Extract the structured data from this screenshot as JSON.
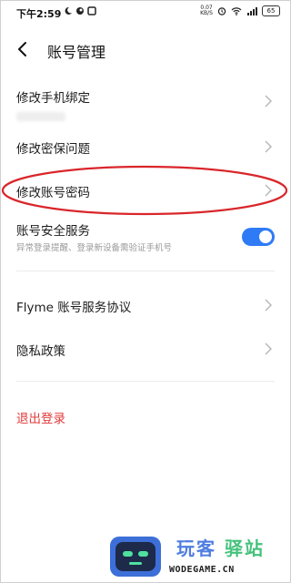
{
  "status_bar": {
    "time": "下午2:59",
    "net_speed_value": "0.07",
    "net_speed_unit": "KB/S",
    "battery": "65",
    "icons": [
      "moon-icon",
      "notification-icon",
      "square-icon",
      "alarm-icon",
      "wifi-icon",
      "signal-icon",
      "battery-icon"
    ]
  },
  "header": {
    "title": "账号管理",
    "back_icon": "chevron-left-icon"
  },
  "menu": {
    "items": [
      {
        "label": "修改手机绑定"
      },
      {
        "label": "修改密保问题"
      },
      {
        "label": "修改账号密码"
      }
    ]
  },
  "security_service": {
    "label": "账号安全服务",
    "description": "异常登录提醒、登录新设备需验证手机号",
    "enabled": true
  },
  "links": {
    "items": [
      {
        "label": "Flyme 账号服务协议"
      },
      {
        "label": "隐私政策"
      }
    ]
  },
  "logout_label": "退出登录",
  "colors": {
    "accent_blue": "#2f7bf6",
    "logout_red": "#e03a3a",
    "annotation_red": "#d9262b"
  },
  "watermark": {
    "brand_a": "玩客",
    "brand_b": "驿站",
    "domain": "WODEGAME.CN"
  }
}
